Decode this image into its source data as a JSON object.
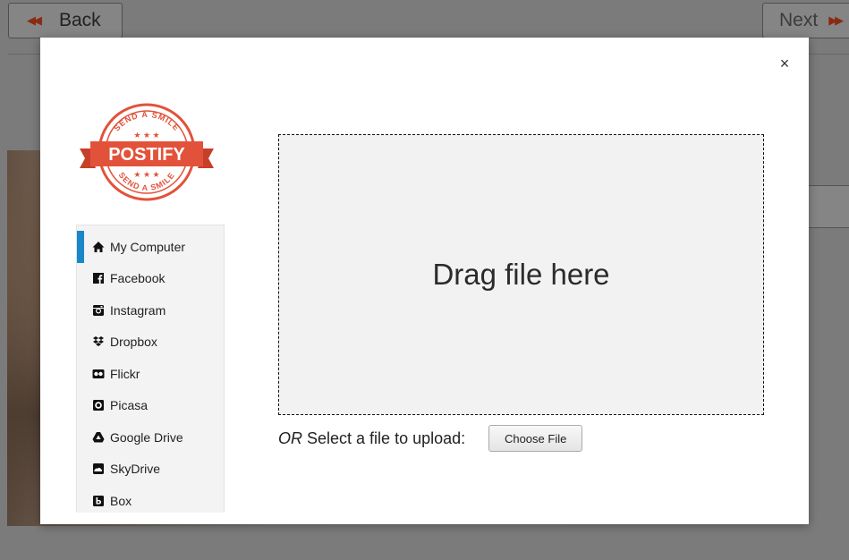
{
  "background": {
    "back_label": "Back",
    "next_label": "Next",
    "side_button_fragment": "e"
  },
  "modal": {
    "close_glyph": "×",
    "logo": {
      "top_arc": "SEND A SMILE",
      "name": "POSTIFY",
      "bottom_arc": "SEND A SMILE",
      "color": "#e2523a"
    },
    "sources": [
      {
        "label": "My Computer",
        "icon": "home-icon",
        "active": true
      },
      {
        "label": "Facebook",
        "icon": "facebook-icon",
        "active": false
      },
      {
        "label": "Instagram",
        "icon": "instagram-icon",
        "active": false
      },
      {
        "label": "Dropbox",
        "icon": "dropbox-icon",
        "active": false
      },
      {
        "label": "Flickr",
        "icon": "flickr-icon",
        "active": false
      },
      {
        "label": "Picasa",
        "icon": "picasa-icon",
        "active": false
      },
      {
        "label": "Google Drive",
        "icon": "google-drive-icon",
        "active": false
      },
      {
        "label": "SkyDrive",
        "icon": "skydrive-icon",
        "active": false
      },
      {
        "label": "Box",
        "icon": "box-icon",
        "active": false
      }
    ],
    "dropzone_text": "Drag file here",
    "upload": {
      "or_text": "OR",
      "label": "Select a file to upload:",
      "button_label": "Choose File"
    },
    "accent_color": "#1a87c9"
  }
}
